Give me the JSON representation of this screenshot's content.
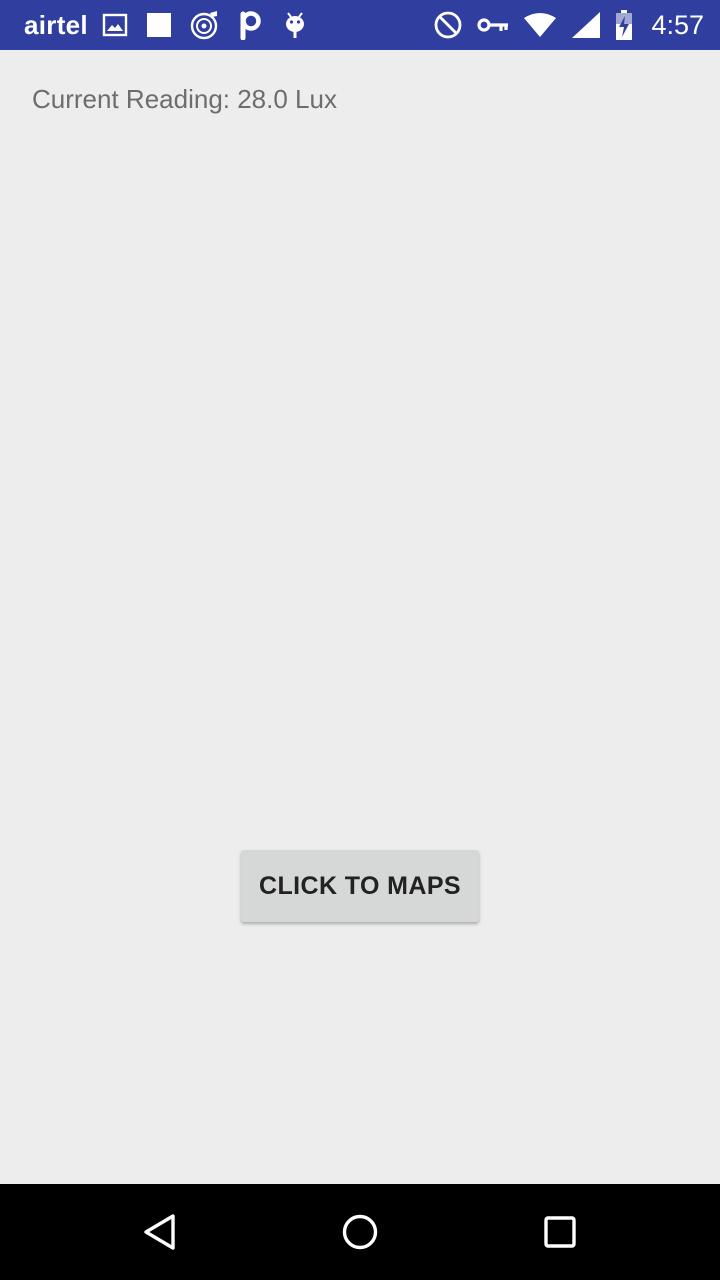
{
  "status_bar": {
    "carrier": "airtel",
    "time": "4:57",
    "background_color": "#303f9f",
    "left_icons": [
      "image-notification-icon",
      "square-notification-icon",
      "music-disc-icon",
      "p-app-icon",
      "android-debug-icon"
    ],
    "right_icons": [
      "do-not-disturb-icon",
      "vpn-key-icon",
      "wifi-icon",
      "cell-signal-icon",
      "battery-charging-icon"
    ]
  },
  "main": {
    "reading_text": "Current Reading: 28.0 Lux",
    "maps_button_label": "CLICK TO MAPS"
  },
  "nav_bar": {
    "icons": [
      "back-icon",
      "home-icon",
      "recents-icon"
    ]
  }
}
